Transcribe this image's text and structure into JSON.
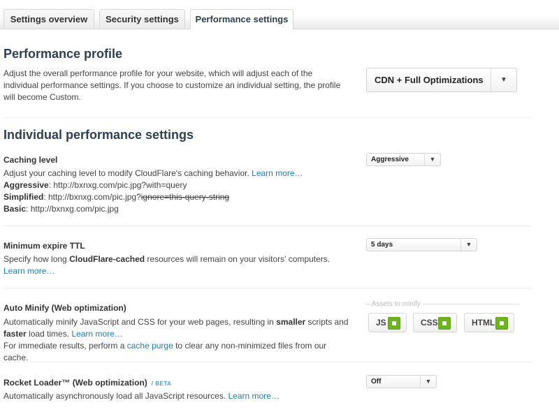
{
  "tabs": [
    {
      "label": "Settings overview",
      "active": false
    },
    {
      "label": "Security settings",
      "active": false
    },
    {
      "label": "Performance settings",
      "active": true
    }
  ],
  "profile": {
    "title": "Performance profile",
    "description": "Adjust the overall performance profile for your website, which will adjust each of the individual performance settings. If you choose to customize an individual setting, the profile will become Custom.",
    "select_value": "CDN + Full Optimizations",
    "caret": "▼"
  },
  "individual": {
    "title": "Individual performance settings"
  },
  "caching": {
    "title": "Caching level",
    "description": "Adjust your caching level to modify CloudFlare's caching behavior.",
    "learn_more": "Learn more…",
    "aggressive_label": "Aggressive",
    "aggressive_url": ": http://bxnxg.com/pic.jpg?with=query",
    "simplified_label": "Simplified",
    "simplified_url": ": http://bxnxg.com/pic.jpg?",
    "simplified_strike": "ignore=this-query-string",
    "basic_label": "Basic",
    "basic_url": ": http://bxnxg.com/pic.jpg",
    "select_value": "Aggressive",
    "caret": "▼"
  },
  "ttl": {
    "title": "Minimum expire TTL",
    "desc_pre": "Specify how long ",
    "desc_bold": "CloudFlare-cached",
    "desc_post": " resources will remain on your visitors' computers.",
    "learn_more": "Learn more…",
    "select_value": "5 days",
    "caret": "▼"
  },
  "minify": {
    "title": "Auto Minify (Web optimization)",
    "desc_1": "Automatically minify JavaScript and CSS for your web pages, resulting in ",
    "desc_bold1": "smaller",
    "desc_2": " scripts and ",
    "desc_bold2": "faster",
    "desc_3": " load times. ",
    "learn_more": "Learn more…",
    "desc_4": "For immediate results, perform a ",
    "cache_purge": "cache purge",
    "desc_5": " to clear any non-minimized files from our cache.",
    "assets_label": "– Assets to minify",
    "assets": [
      {
        "label": "JS",
        "checked": true
      },
      {
        "label": "CSS",
        "checked": true
      },
      {
        "label": "HTML",
        "checked": true
      }
    ]
  },
  "rocket": {
    "title": "Rocket Loader™ (Web optimization)",
    "beta": "/ BETA",
    "description": "Automatically asynchronously load all JavaScript resources.",
    "learn_more": "Learn more…",
    "select_value": "Off",
    "caret": "▼"
  },
  "colors": {
    "accent_link": "#1a7dc4",
    "check_green": "#6cb51c",
    "heading": "#2f3f52"
  }
}
